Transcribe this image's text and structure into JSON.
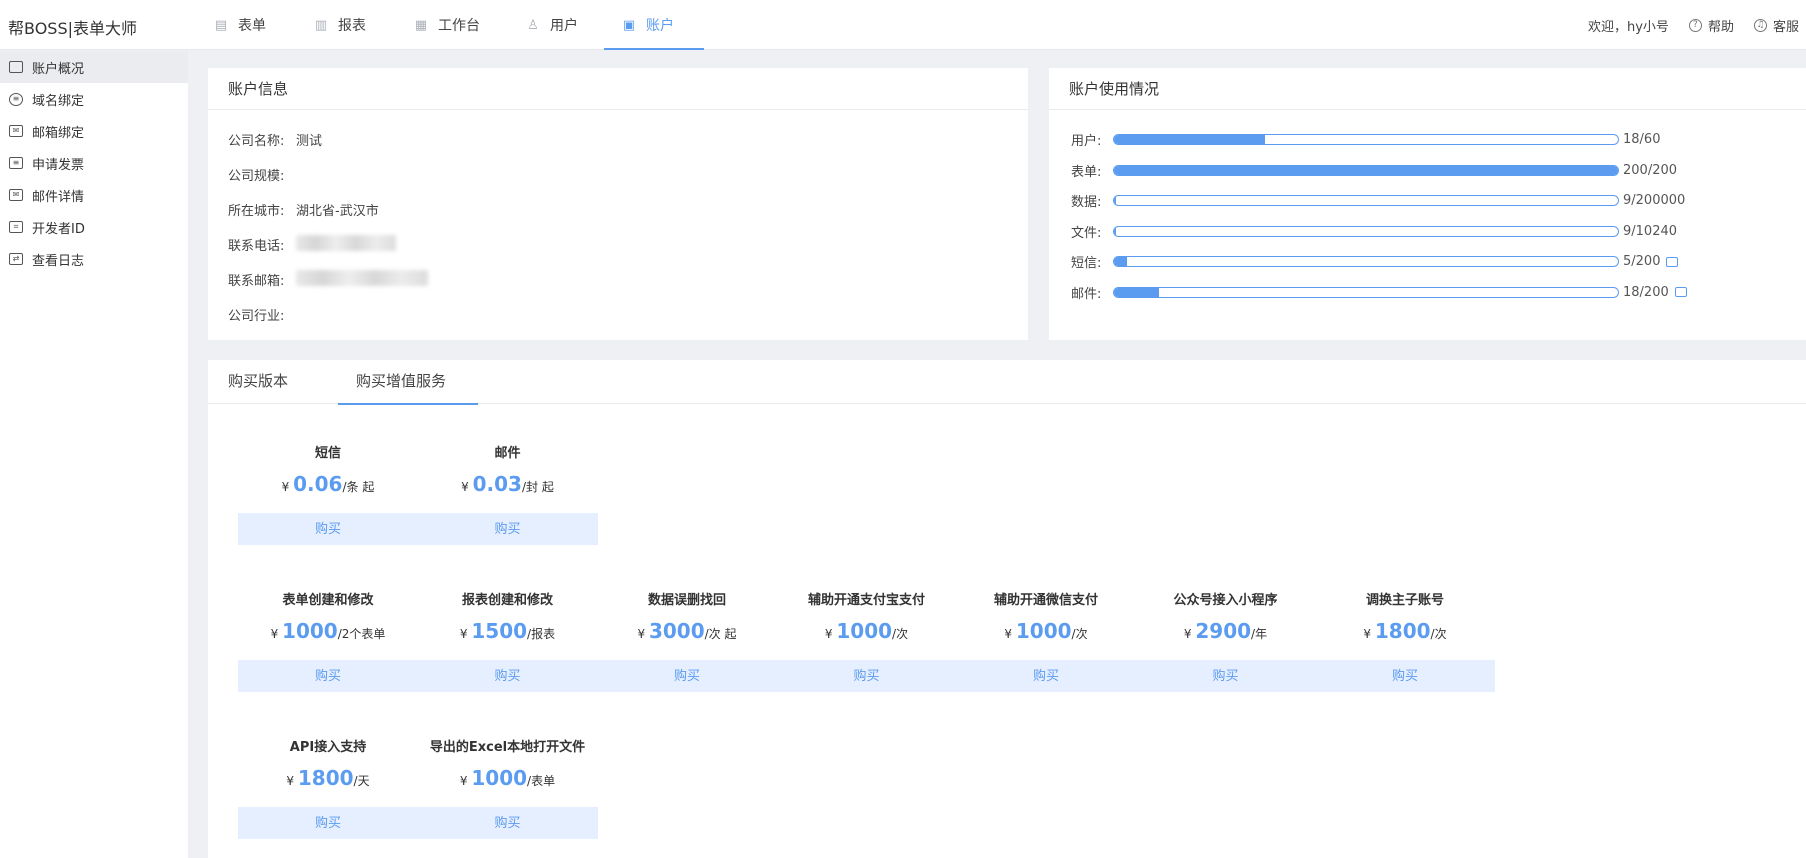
{
  "brand": "帮BOSS|表单大师",
  "nav": [
    {
      "label": "表单",
      "icon": "form-icon"
    },
    {
      "label": "报表",
      "icon": "chart-icon"
    },
    {
      "label": "工作台",
      "icon": "workbench-icon"
    },
    {
      "label": "用户",
      "icon": "user-icon"
    },
    {
      "label": "账户",
      "icon": "wallet-icon",
      "active": true
    }
  ],
  "top_right": {
    "welcome": "欢迎，hy小号",
    "help": "帮助",
    "service": "客服"
  },
  "sidebar": [
    {
      "label": "账户概况",
      "active": true
    },
    {
      "label": "域名绑定"
    },
    {
      "label": "邮箱绑定"
    },
    {
      "label": "申请发票"
    },
    {
      "label": "邮件详情"
    },
    {
      "label": "开发者ID"
    },
    {
      "label": "查看日志"
    }
  ],
  "account_info": {
    "title": "账户信息",
    "rows": [
      {
        "key": "公司名称:",
        "value": "测试"
      },
      {
        "key": "公司规模:",
        "value": ""
      },
      {
        "key": "所在城市:",
        "value": "湖北省-武汉市"
      },
      {
        "key": "联系电话:",
        "value": ""
      },
      {
        "key": "联系邮箱:",
        "value": ""
      },
      {
        "key": "公司行业:",
        "value": ""
      }
    ]
  },
  "usage": {
    "title": "账户使用情况",
    "rows": [
      {
        "key": "用户:",
        "value": "18/60",
        "fraction": 0.3
      },
      {
        "key": "表单:",
        "value": "200/200",
        "fraction": 1.0
      },
      {
        "key": "数据:",
        "value": "9/200000",
        "fraction": 5e-05
      },
      {
        "key": "文件:",
        "value": "9/10240",
        "fraction": 0.001
      },
      {
        "key": "短信:",
        "value": "5/200",
        "fraction": 0.025,
        "icon": "sms-icon"
      },
      {
        "key": "邮件:",
        "value": "18/200",
        "fraction": 0.09,
        "icon": "mail-icon"
      }
    ]
  },
  "shop": {
    "tabs": [
      {
        "label": "购买版本"
      },
      {
        "label": "购买增值服务",
        "active": true
      }
    ],
    "buy_label": "购买",
    "currency": "¥",
    "items": [
      {
        "name": "短信",
        "price": "0.06",
        "unit": "/条 起"
      },
      {
        "name": "邮件",
        "price": "0.03",
        "unit": "/封 起"
      },
      {
        "name": "表单创建和修改",
        "price": "1000",
        "unit": "/2个表单"
      },
      {
        "name": "报表创建和修改",
        "price": "1500",
        "unit": "/报表"
      },
      {
        "name": "数据误删找回",
        "price": "3000",
        "unit": "/次 起"
      },
      {
        "name": "辅助开通支付宝支付",
        "price": "1000",
        "unit": "/次"
      },
      {
        "name": "辅助开通微信支付",
        "price": "1000",
        "unit": "/次"
      },
      {
        "name": "公众号接入小程序",
        "price": "2900",
        "unit": "/年"
      },
      {
        "name": "调换主子账号",
        "price": "1800",
        "unit": "/次"
      },
      {
        "name": "API接入支持",
        "price": "1800",
        "unit": "/天"
      },
      {
        "name": "导出的Excel本地打开文件",
        "price": "1000",
        "unit": "/表单"
      }
    ]
  }
}
